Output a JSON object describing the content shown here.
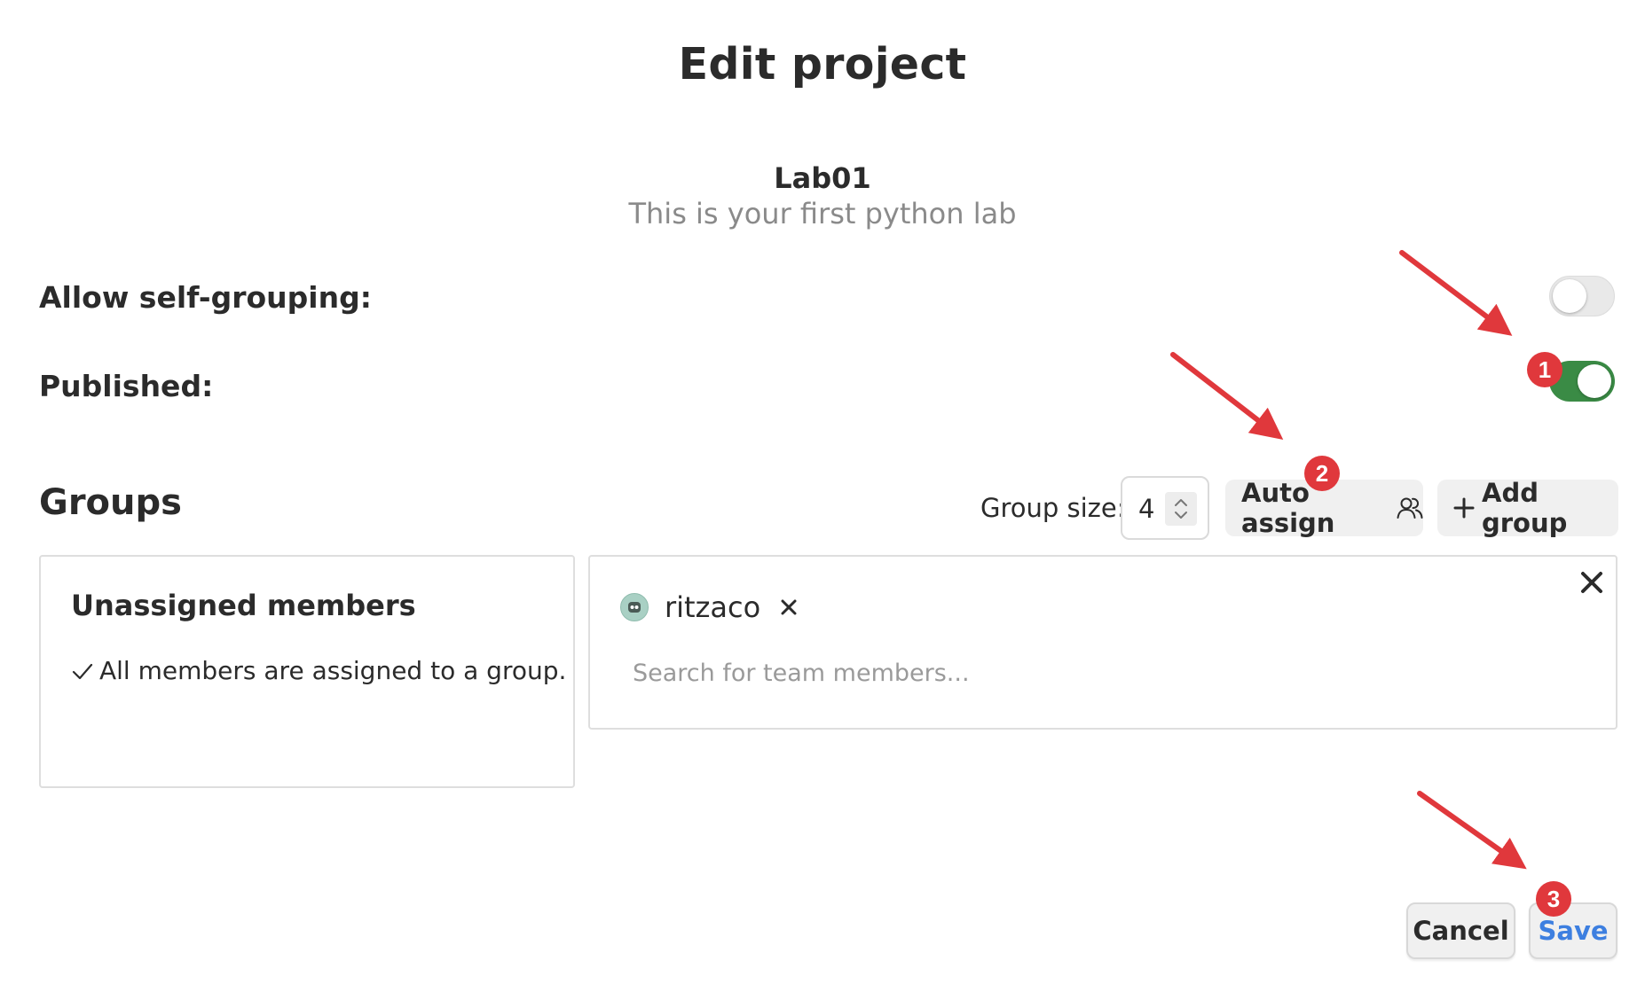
{
  "dialog": {
    "title": "Edit project"
  },
  "project": {
    "name": "Lab01",
    "description": "This is your first python lab"
  },
  "settings": {
    "self_grouping_label": "Allow self-grouping:",
    "self_grouping_enabled": false,
    "published_label": "Published:",
    "published_enabled": true
  },
  "groups": {
    "heading": "Groups",
    "group_size_label": "Group size:",
    "group_size_value": "4",
    "auto_assign_label": "Auto assign",
    "add_group_label": "Add group",
    "unassigned": {
      "title": "Unassigned members",
      "message": "All members are assigned to a group."
    },
    "group": {
      "members": [
        {
          "name": "ritzaco"
        }
      ],
      "search_placeholder": "Search for team members..."
    }
  },
  "footer": {
    "cancel_label": "Cancel",
    "save_label": "Save"
  },
  "annotations": {
    "badges": [
      "1",
      "2",
      "3"
    ],
    "arrow_color": "#e0383c"
  },
  "colors": {
    "toggle_on": "#3a8b45",
    "save_text": "#3d7fe0",
    "badge": "#e0383c"
  },
  "icons": [
    "users-icon",
    "plus-icon",
    "check-icon",
    "close-icon",
    "stepper-icon",
    "avatar-icon"
  ]
}
